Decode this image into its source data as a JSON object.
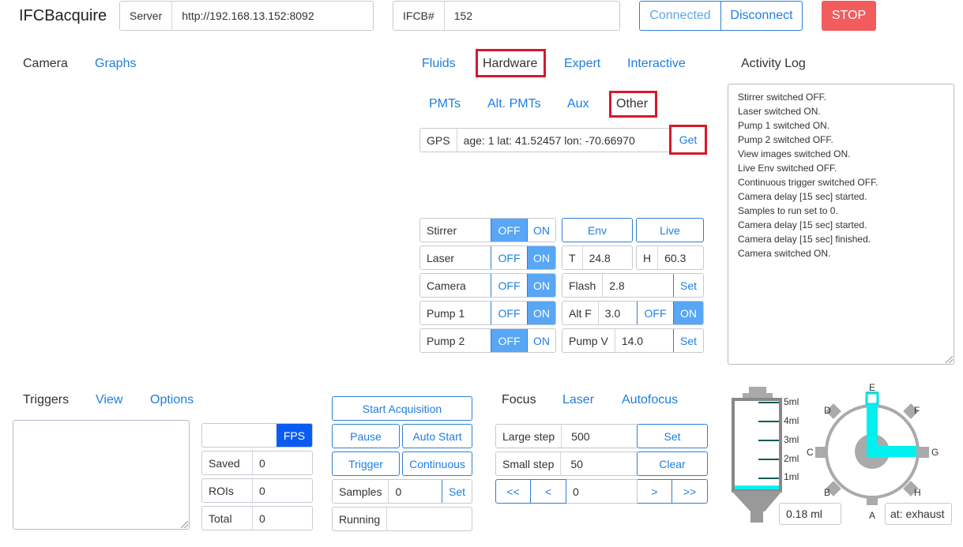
{
  "header": {
    "app_title": "IFCBacquire",
    "server_label": "Server",
    "server_value": "http://192.168.13.152:8092",
    "ifcb_label": "IFCB#",
    "ifcb_value": "152",
    "connected_label": "Connected",
    "disconnect_label": "Disconnect",
    "stop_label": "STOP"
  },
  "left_tabs": {
    "camera": "Camera",
    "graphs": "Graphs"
  },
  "middle_tabs": {
    "fluids": "Fluids",
    "hardware": "Hardware",
    "expert": "Expert",
    "interactive": "Interactive"
  },
  "sub_tabs": {
    "pmts": "PMTs",
    "alt_pmts": "Alt. PMTs",
    "aux": "Aux",
    "other": "Other"
  },
  "gps": {
    "label": "GPS",
    "value": "age: 1 lat: 41.52457 lon: -70.66970",
    "get_label": "Get"
  },
  "switches": [
    {
      "label": "Stirrer",
      "off": "OFF",
      "on": "ON",
      "state": "off"
    },
    {
      "label": "Laser",
      "off": "OFF",
      "on": "ON",
      "state": "on"
    },
    {
      "label": "Camera",
      "off": "OFF",
      "on": "ON",
      "state": "on"
    },
    {
      "label": "Pump 1",
      "off": "OFF",
      "on": "ON",
      "state": "on"
    },
    {
      "label": "Pump 2",
      "off": "OFF",
      "on": "ON",
      "state": "off"
    }
  ],
  "env": {
    "env_label": "Env",
    "live_label": "Live",
    "t_label": "T",
    "t_value": "24.8",
    "h_label": "H",
    "h_value": "60.3",
    "flash_label": "Flash",
    "flash_value": "2.8",
    "flash_set": "Set",
    "altf_label": "Alt F",
    "altf_value": "3.0",
    "altf_off": "OFF",
    "altf_on": "ON",
    "pumpv_label": "Pump V",
    "pumpv_value": "14.0",
    "pumpv_set": "Set"
  },
  "activity_log": {
    "title": "Activity Log",
    "lines": [
      "Stirrer switched OFF.",
      "Laser switched ON.",
      "Pump 1 switched ON.",
      "Pump 2 switched OFF.",
      "View images switched ON.",
      "Live Env switched OFF.",
      "Continuous trigger switched OFF.",
      "Camera delay [15 sec] started.",
      "Samples to run set to 0.",
      "Camera delay [15 sec] started.",
      "Camera delay [15 sec] finished.",
      "Camera switched ON."
    ]
  },
  "triggers_tabs": {
    "triggers": "Triggers",
    "view": "View",
    "options": "Options"
  },
  "stats": {
    "fps_label": "FPS",
    "fps_value": "",
    "saved_label": "Saved",
    "saved_value": "0",
    "rois_label": "ROIs",
    "rois_value": "0",
    "total_label": "Total",
    "total_value": "0"
  },
  "acquisition": {
    "start_label": "Start Acquisition",
    "pause_label": "Pause",
    "auto_start_label": "Auto Start",
    "trigger_label": "Trigger",
    "continuous_label": "Continuous",
    "samples_label": "Samples",
    "samples_value": "0",
    "samples_set": "Set",
    "running_label": "Running",
    "running_value": ""
  },
  "focus_tabs": {
    "focus": "Focus",
    "laser": "Laser",
    "autofocus": "Autofocus"
  },
  "focus": {
    "large_step_label": "Large step",
    "large_step_value": "500",
    "set_label": "Set",
    "small_step_label": "Small step",
    "small_step_value": "50",
    "clear_label": "Clear",
    "btn_ll": "<<",
    "btn_l": "<",
    "position_value": "0",
    "btn_r": ">",
    "btn_rr": ">>"
  },
  "syringe": {
    "ticks": [
      "5ml",
      "4ml",
      "3ml",
      "2ml",
      "1ml"
    ],
    "volume": "0.18 ml",
    "fill_fraction": 0.04
  },
  "valve": {
    "ports": [
      "A",
      "B",
      "C",
      "D",
      "E",
      "F",
      "G",
      "H"
    ],
    "position": "at: exhaust",
    "accent_color": "#00f0f0"
  },
  "colors": {
    "accent": "#1f7ee0",
    "on_fill": "#58a6f6",
    "stop": "#f25c5c",
    "highlight": "#d8182a"
  }
}
